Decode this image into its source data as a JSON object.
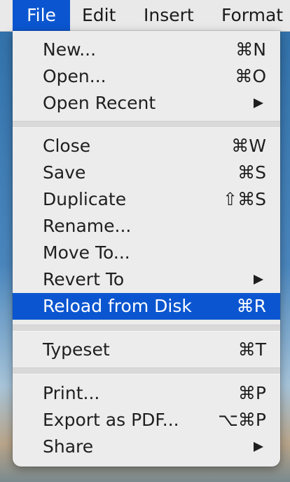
{
  "menubar": {
    "items": [
      {
        "label": "File",
        "active": true
      },
      {
        "label": "Edit"
      },
      {
        "label": "Insert"
      },
      {
        "label": "Format"
      }
    ]
  },
  "file_menu": {
    "groups": [
      [
        {
          "label": "New...",
          "shortcut": "⌘N"
        },
        {
          "label": "Open...",
          "shortcut": "⌘O"
        },
        {
          "label": "Open Recent",
          "submenu": true
        }
      ],
      [
        {
          "label": "Close",
          "shortcut": "⌘W"
        },
        {
          "label": "Save",
          "shortcut": "⌘S"
        },
        {
          "label": "Duplicate",
          "shortcut": "⇧⌘S"
        },
        {
          "label": "Rename..."
        },
        {
          "label": "Move To..."
        },
        {
          "label": "Revert To",
          "submenu": true
        },
        {
          "label": "Reload from Disk",
          "shortcut": "⌘R",
          "highlighted": true
        }
      ],
      [
        {
          "label": "Typeset",
          "shortcut": "⌘T"
        }
      ],
      [
        {
          "label": "Print...",
          "shortcut": "⌘P"
        },
        {
          "label": "Export as PDF...",
          "shortcut": "⌥⌘P"
        },
        {
          "label": "Share",
          "submenu": true
        }
      ]
    ]
  }
}
